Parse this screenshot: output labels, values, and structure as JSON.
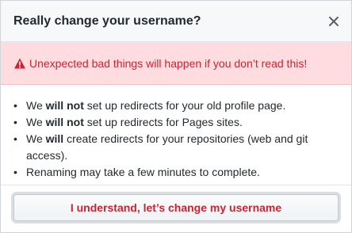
{
  "dialog": {
    "title": "Really change your username?",
    "close_icon": "close-icon"
  },
  "flash": {
    "icon": "alert-icon",
    "text": "Unexpected bad things will happen if you don’t read this!",
    "color": "#cb2431",
    "background": "#ffdce0"
  },
  "list": {
    "items": [
      {
        "bullet": "•",
        "pre": "We ",
        "bold": "will not",
        "post": " set up redirects for your old profile page."
      },
      {
        "bullet": "•",
        "pre": "We ",
        "bold": "will not",
        "post": " set up redirects for Pages sites."
      },
      {
        "bullet": "•",
        "pre": "We ",
        "bold": "will",
        "post": " create redirects for your repositories (web and git access)."
      },
      {
        "bullet": "•",
        "pre": "Renaming may take a few minutes to complete.",
        "bold": "",
        "post": ""
      }
    ]
  },
  "footer": {
    "confirm_label": "I understand, let’s change my username",
    "danger_color": "#cb2431"
  }
}
